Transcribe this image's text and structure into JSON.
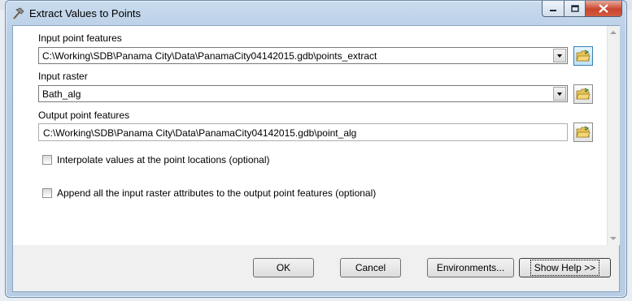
{
  "window": {
    "title": "Extract Values to Points"
  },
  "params": {
    "input_point_features": {
      "label": "Input point features",
      "value": "C:\\Working\\SDB\\Panama City\\Data\\PanamaCity04142015.gdb\\points_extract"
    },
    "input_raster": {
      "label": "Input raster",
      "value": "Bath_alg"
    },
    "output_point_features": {
      "label": "Output point features",
      "value": "C:\\Working\\SDB\\Panama City\\Data\\PanamaCity04142015.gdb\\point_alg"
    },
    "interpolate": {
      "label": "Interpolate values at the point locations (optional)",
      "checked": false
    },
    "append": {
      "label": "Append all the input raster attributes to the output point features (optional)",
      "checked": false
    }
  },
  "buttons": {
    "ok": "OK",
    "cancel": "Cancel",
    "environments": "Environments...",
    "show_help": "Show Help >>"
  },
  "icons": {
    "title": "hammer-tool-icon",
    "browse": "open-folder-icon"
  }
}
